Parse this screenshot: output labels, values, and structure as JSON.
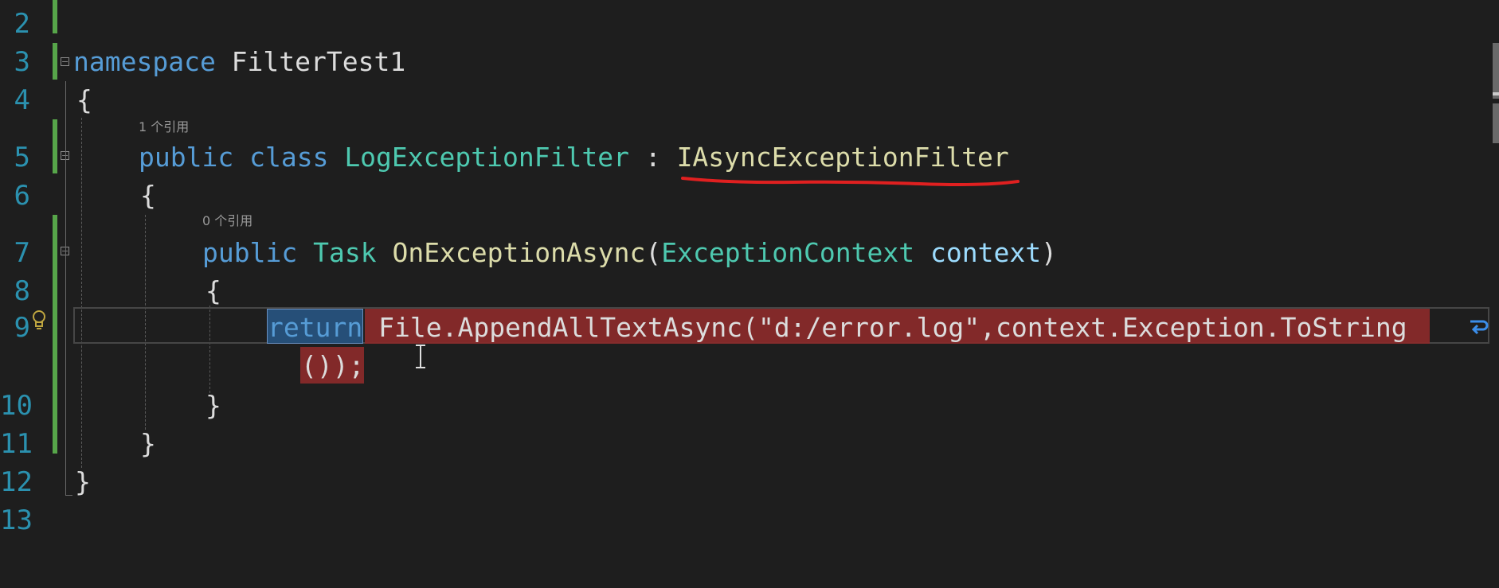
{
  "editor": {
    "line_numbers": [
      "2",
      "3",
      "4",
      "5",
      "6",
      "7",
      "8",
      "9",
      "10",
      "11",
      "12",
      "13"
    ],
    "codelens": {
      "class_refs": "1 个引用",
      "method_refs": "0 个引用"
    },
    "tokens": {
      "ns_kw": "namespace",
      "ns_name": " FilterTest1",
      "brace_open": "{",
      "brace_close": "}",
      "public": "public",
      "class_kw": "class",
      "class_name": "LogExceptionFilter",
      "colon": ":",
      "interface": "IAsyncExceptionFilter",
      "task": "Task",
      "method": "OnExceptionAsync",
      "paren_open": "(",
      "param_type": "ExceptionContext",
      "param_name": "context",
      "paren_close": ")",
      "return_kw": "return",
      "file": "File",
      "dot": ".",
      "append": "AppendAllTextAsync",
      "string": "\"d:/error.log\"",
      "comma": ",",
      "ctx": "context",
      "exception": "Exception",
      "tostring": "ToString",
      "tail": "());"
    }
  },
  "colors": {
    "background": "#1e1e1e",
    "keyword": "#569cd6",
    "type": "#4ec9b0",
    "method": "#dcdcaa",
    "line_number": "#2b91af",
    "selection": "#264f78",
    "highlight_red": "#8b2a2a",
    "annotation_underline": "#e02020",
    "change_bar": "#57a64a"
  }
}
